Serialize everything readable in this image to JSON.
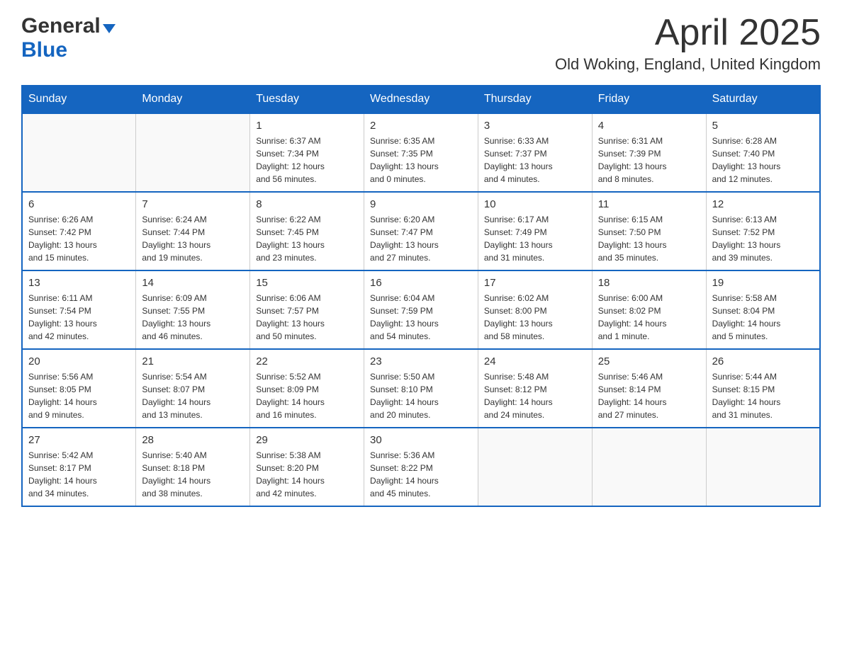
{
  "header": {
    "logo_line1": "General",
    "logo_line2": "Blue",
    "month": "April 2025",
    "location": "Old Woking, England, United Kingdom"
  },
  "days_of_week": [
    "Sunday",
    "Monday",
    "Tuesday",
    "Wednesday",
    "Thursday",
    "Friday",
    "Saturday"
  ],
  "weeks": [
    [
      {
        "day": "",
        "info": ""
      },
      {
        "day": "",
        "info": ""
      },
      {
        "day": "1",
        "info": "Sunrise: 6:37 AM\nSunset: 7:34 PM\nDaylight: 12 hours\nand 56 minutes."
      },
      {
        "day": "2",
        "info": "Sunrise: 6:35 AM\nSunset: 7:35 PM\nDaylight: 13 hours\nand 0 minutes."
      },
      {
        "day": "3",
        "info": "Sunrise: 6:33 AM\nSunset: 7:37 PM\nDaylight: 13 hours\nand 4 minutes."
      },
      {
        "day": "4",
        "info": "Sunrise: 6:31 AM\nSunset: 7:39 PM\nDaylight: 13 hours\nand 8 minutes."
      },
      {
        "day": "5",
        "info": "Sunrise: 6:28 AM\nSunset: 7:40 PM\nDaylight: 13 hours\nand 12 minutes."
      }
    ],
    [
      {
        "day": "6",
        "info": "Sunrise: 6:26 AM\nSunset: 7:42 PM\nDaylight: 13 hours\nand 15 minutes."
      },
      {
        "day": "7",
        "info": "Sunrise: 6:24 AM\nSunset: 7:44 PM\nDaylight: 13 hours\nand 19 minutes."
      },
      {
        "day": "8",
        "info": "Sunrise: 6:22 AM\nSunset: 7:45 PM\nDaylight: 13 hours\nand 23 minutes."
      },
      {
        "day": "9",
        "info": "Sunrise: 6:20 AM\nSunset: 7:47 PM\nDaylight: 13 hours\nand 27 minutes."
      },
      {
        "day": "10",
        "info": "Sunrise: 6:17 AM\nSunset: 7:49 PM\nDaylight: 13 hours\nand 31 minutes."
      },
      {
        "day": "11",
        "info": "Sunrise: 6:15 AM\nSunset: 7:50 PM\nDaylight: 13 hours\nand 35 minutes."
      },
      {
        "day": "12",
        "info": "Sunrise: 6:13 AM\nSunset: 7:52 PM\nDaylight: 13 hours\nand 39 minutes."
      }
    ],
    [
      {
        "day": "13",
        "info": "Sunrise: 6:11 AM\nSunset: 7:54 PM\nDaylight: 13 hours\nand 42 minutes."
      },
      {
        "day": "14",
        "info": "Sunrise: 6:09 AM\nSunset: 7:55 PM\nDaylight: 13 hours\nand 46 minutes."
      },
      {
        "day": "15",
        "info": "Sunrise: 6:06 AM\nSunset: 7:57 PM\nDaylight: 13 hours\nand 50 minutes."
      },
      {
        "day": "16",
        "info": "Sunrise: 6:04 AM\nSunset: 7:59 PM\nDaylight: 13 hours\nand 54 minutes."
      },
      {
        "day": "17",
        "info": "Sunrise: 6:02 AM\nSunset: 8:00 PM\nDaylight: 13 hours\nand 58 minutes."
      },
      {
        "day": "18",
        "info": "Sunrise: 6:00 AM\nSunset: 8:02 PM\nDaylight: 14 hours\nand 1 minute."
      },
      {
        "day": "19",
        "info": "Sunrise: 5:58 AM\nSunset: 8:04 PM\nDaylight: 14 hours\nand 5 minutes."
      }
    ],
    [
      {
        "day": "20",
        "info": "Sunrise: 5:56 AM\nSunset: 8:05 PM\nDaylight: 14 hours\nand 9 minutes."
      },
      {
        "day": "21",
        "info": "Sunrise: 5:54 AM\nSunset: 8:07 PM\nDaylight: 14 hours\nand 13 minutes."
      },
      {
        "day": "22",
        "info": "Sunrise: 5:52 AM\nSunset: 8:09 PM\nDaylight: 14 hours\nand 16 minutes."
      },
      {
        "day": "23",
        "info": "Sunrise: 5:50 AM\nSunset: 8:10 PM\nDaylight: 14 hours\nand 20 minutes."
      },
      {
        "day": "24",
        "info": "Sunrise: 5:48 AM\nSunset: 8:12 PM\nDaylight: 14 hours\nand 24 minutes."
      },
      {
        "day": "25",
        "info": "Sunrise: 5:46 AM\nSunset: 8:14 PM\nDaylight: 14 hours\nand 27 minutes."
      },
      {
        "day": "26",
        "info": "Sunrise: 5:44 AM\nSunset: 8:15 PM\nDaylight: 14 hours\nand 31 minutes."
      }
    ],
    [
      {
        "day": "27",
        "info": "Sunrise: 5:42 AM\nSunset: 8:17 PM\nDaylight: 14 hours\nand 34 minutes."
      },
      {
        "day": "28",
        "info": "Sunrise: 5:40 AM\nSunset: 8:18 PM\nDaylight: 14 hours\nand 38 minutes."
      },
      {
        "day": "29",
        "info": "Sunrise: 5:38 AM\nSunset: 8:20 PM\nDaylight: 14 hours\nand 42 minutes."
      },
      {
        "day": "30",
        "info": "Sunrise: 5:36 AM\nSunset: 8:22 PM\nDaylight: 14 hours\nand 45 minutes."
      },
      {
        "day": "",
        "info": ""
      },
      {
        "day": "",
        "info": ""
      },
      {
        "day": "",
        "info": ""
      }
    ]
  ]
}
